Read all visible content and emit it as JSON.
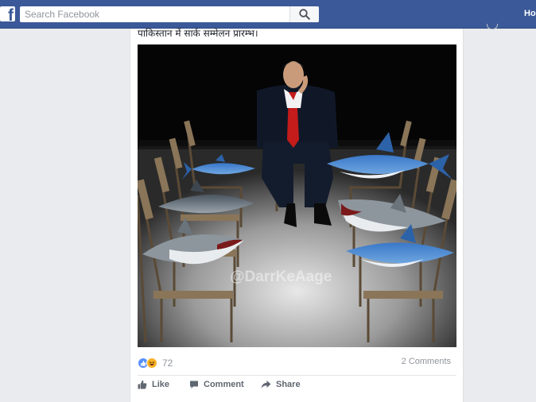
{
  "topbar": {
    "logo_letter": "f",
    "search_placeholder": "Search Facebook",
    "search_value": "",
    "nav_home_label": "Home"
  },
  "post": {
    "text": "पाकिस्तान में सार्क सम्मेलन प्रारम्भ।",
    "image_watermark": "@DarrKeAage",
    "reaction_count": "72",
    "comments_label": "2 Comments",
    "actions": {
      "like": "Like",
      "comment": "Comment",
      "share": "Share"
    }
  },
  "icons": {
    "search": "search-icon",
    "like_reaction": "like-reaction-icon",
    "haha_reaction": "haha-reaction-icon",
    "like_action": "thumbs-up-icon",
    "comment_action": "comment-bubble-icon",
    "share_action": "share-arrow-icon"
  },
  "colors": {
    "brand_blue": "#3b5998",
    "background": "#e9ebee",
    "like_blue": "#5890ff",
    "haha_yellow": "#f7b125",
    "muted_text": "#90949c"
  }
}
